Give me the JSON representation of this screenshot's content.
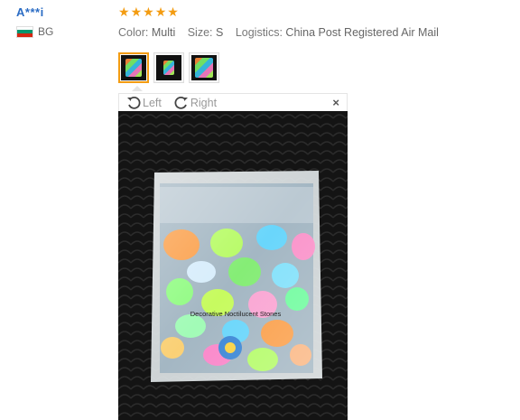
{
  "reviewer": {
    "name": "A***i",
    "country_code": "BG",
    "flag_colors": [
      "#ffffff",
      "#00966e",
      "#d62612"
    ]
  },
  "rating": {
    "stars": 5,
    "max": 5,
    "color": "#f39c12"
  },
  "attributes": [
    {
      "key": "Color:",
      "value": "Multi"
    },
    {
      "key": "Size:",
      "value": "S"
    },
    {
      "key": "Logistics:",
      "value": "China Post Registered Air Mail"
    }
  ],
  "thumbnails": {
    "count": 3,
    "active_index": 0
  },
  "viewer": {
    "rotate_left_label": "Left",
    "rotate_right_label": "Right",
    "close_label": "×"
  },
  "photo": {
    "bag_label": "Decorative Noctilucent Stones"
  },
  "icons": {
    "rotate_left": "rotate-left-icon",
    "rotate_right": "rotate-right-icon",
    "close": "close-icon",
    "star": "star-icon"
  }
}
